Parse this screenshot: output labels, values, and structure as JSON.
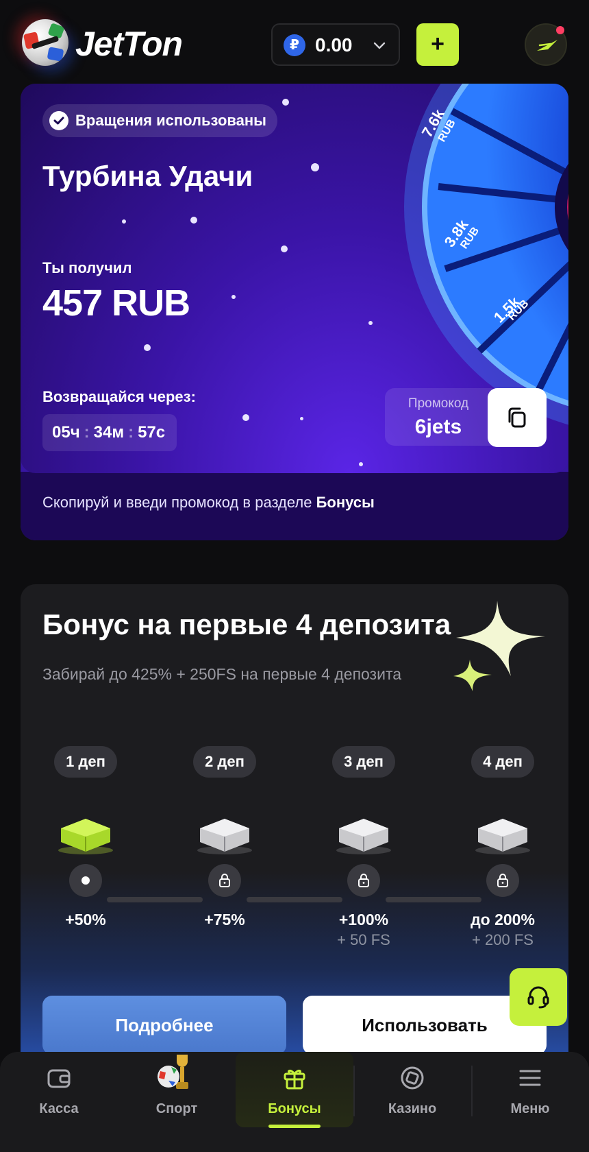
{
  "header": {
    "logo_text": "JetTon",
    "balance": {
      "currency_symbol": "₽",
      "value": "0.00"
    },
    "deposit_button_label": "+"
  },
  "wheel_card": {
    "status_badge": "Вращения использованы",
    "title": "Турбина Удачи",
    "received_label": "Ты получил",
    "received_value": "457 RUB",
    "return_label": "Возвращайся через:",
    "timer": {
      "hours": "05ч",
      "minutes": "34м",
      "seconds": "57с"
    },
    "promo_label": "Промокод",
    "promo_code": "6jets",
    "hint_text": "Скопируй и введи промокод в разделе ",
    "hint_bold": "Бонусы",
    "wheel_sectors": [
      "7.6k RUB",
      "3.8k RUB",
      "1.5k RUB"
    ]
  },
  "deposit_card": {
    "title": "Бонус на первые 4 депозита",
    "subtitle": "Забирай до 425% + 250FS на первые 4 депозита",
    "steps": [
      {
        "label": "1 деп",
        "percent": "+50%",
        "fs": "",
        "state": "active"
      },
      {
        "label": "2 деп",
        "percent": "+75%",
        "fs": "",
        "state": "locked"
      },
      {
        "label": "3 деп",
        "percent": "+100%",
        "fs": "+ 50 FS",
        "state": "locked"
      },
      {
        "label": "4 деп",
        "percent": "до 200%",
        "fs": "+ 200 FS",
        "state": "locked"
      }
    ],
    "more_button": "Подробнее",
    "use_button": "Использовать"
  },
  "bottom_nav": [
    {
      "label": "Касса",
      "icon": "wallet-icon"
    },
    {
      "label": "Спорт",
      "icon": "trophy-ball-icon"
    },
    {
      "label": "Бонусы",
      "icon": "gift-icon",
      "active": true
    },
    {
      "label": "Казино",
      "icon": "chip-icon"
    },
    {
      "label": "Меню",
      "icon": "menu-icon"
    }
  ],
  "colors": {
    "accent": "#c5f03c",
    "bg": "#0d0d0f",
    "card": "#1c1c1f",
    "purple": "#3a14a6"
  }
}
